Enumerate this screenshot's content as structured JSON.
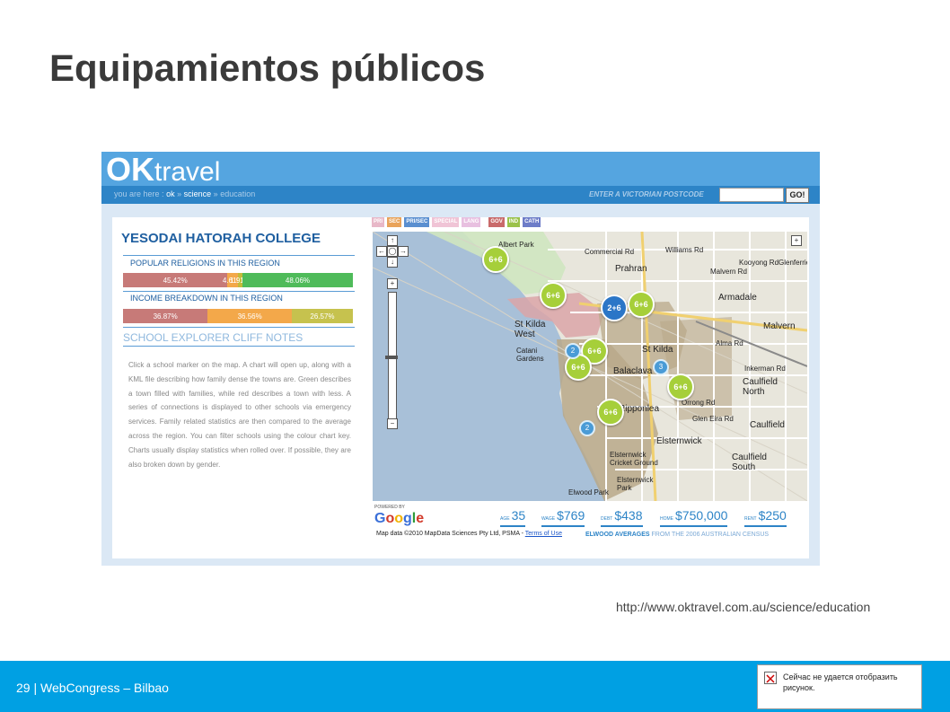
{
  "slide": {
    "title": "Equipamientos públicos",
    "source_url": "http://www.oktravel.com.au/science/education",
    "footer_text": "29 | WebCongress – Bilbao",
    "error_message": "Сейчас не удается отобразить рисунок."
  },
  "site": {
    "logo_ok": "OK",
    "logo_travel": "travel",
    "breadcrumb": {
      "prefix": "you are here :",
      "items": [
        "ok",
        "science",
        "education"
      ],
      "separator": "»"
    },
    "postcode_label": "ENTER A VICTORIAN POSTCODE",
    "postcode_value": "",
    "go_label": "GO!",
    "accent_color": "#2d84c7"
  },
  "panel": {
    "college_name": "YESODAI HATORAH COLLEGE",
    "religions": {
      "title": "POPULAR RELIGIONS IN THIS REGION",
      "segments": [
        {
          "label": "45.42%",
          "percent": 45.42,
          "color": "#c77a78"
        },
        {
          "label": "4.61%",
          "percent": 4.61,
          "color": "#f3a84a"
        },
        {
          "label": "1.91%",
          "percent": 1.91,
          "color": "#c3bb3a"
        },
        {
          "label": "48.06%",
          "percent": 48.06,
          "color": "#4fbb5a"
        }
      ]
    },
    "income": {
      "title": "INCOME BREAKDOWN IN THIS REGION",
      "segments": [
        {
          "label": "36.87%",
          "percent": 36.87,
          "color": "#c77a78"
        },
        {
          "label": "36.56%",
          "percent": 36.56,
          "color": "#f3a84a"
        },
        {
          "label": "26.57%",
          "percent": 26.57,
          "color": "#c6c24e"
        }
      ]
    },
    "cliff_notes_title": "SCHOOL EXPLORER CLIFF NOTES",
    "cliff_notes_text": "Click a school marker on the map. A chart will open up, along with a KML file describing how family dense the towns are. Green describes a town filled with families, while red describes a town with less. A series of connections is displayed to other schools via emergency services. Family related statistics are then compared to the average across the region. You can filter schools using the colour chart key. Charts usually display statistics when rolled over. If possible, they are also broken down by gender."
  },
  "map": {
    "filters": [
      {
        "label": "PRI",
        "color": "#e8b8c8"
      },
      {
        "label": "SEC",
        "color": "#e9a35a"
      },
      {
        "label": "PRI/SEC",
        "color": "#5a8fd0"
      },
      {
        "label": "SPECIAL",
        "color": "#f0c4d6"
      },
      {
        "label": "LANG",
        "color": "#e8c0e0"
      },
      {
        "label": "GOV",
        "color": "#c96a6a"
      },
      {
        "label": "IND",
        "color": "#9bc24a"
      },
      {
        "label": "CATH",
        "color": "#6d7cc8"
      }
    ],
    "suburbs": [
      "Prahran",
      "Armadale",
      "Malvern",
      "St Kilda West",
      "St Kilda",
      "Balaclava",
      "Ripponlea",
      "Caulfield North",
      "Caulfield",
      "Elsternwick",
      "Caulfield South",
      "Albert Park",
      "Elwood Park",
      "Catani Gardens",
      "Elsternwick Cricket Ground",
      "Elsternwick Park",
      "Glen Eira Rd",
      "Inkerman Rd",
      "Alma Rd",
      "Williams Rd",
      "Malvern Rd",
      "Orrong Rd",
      "Kooyong Rd",
      "Glenferrie Rd",
      "Commercial Rd"
    ],
    "school_markers": [
      "6+6",
      "6+6",
      "2+6",
      "6+6",
      "6+6",
      "6+6",
      "6+6",
      "6+6"
    ],
    "cluster_counts": [
      "3",
      "2",
      "2"
    ],
    "powered_by": "POWERED BY",
    "google": "Google",
    "attribution": "Map data ©2010 MapData Sciences Pty Ltd, PSMA -",
    "terms_link": "Terms of Use"
  },
  "stats": {
    "items": [
      {
        "label": "AGE",
        "value": "35"
      },
      {
        "label": "WAGE",
        "value": "$769"
      },
      {
        "label": "DEBT",
        "value": "$438"
      },
      {
        "label": "HOME",
        "value": "$750,000"
      },
      {
        "label": "RENT",
        "value": "$250"
      }
    ],
    "averages_label": "ELWOOD AVERAGES",
    "census_note": "FROM THE 2006 AUSTRALIAN CENSUS"
  }
}
